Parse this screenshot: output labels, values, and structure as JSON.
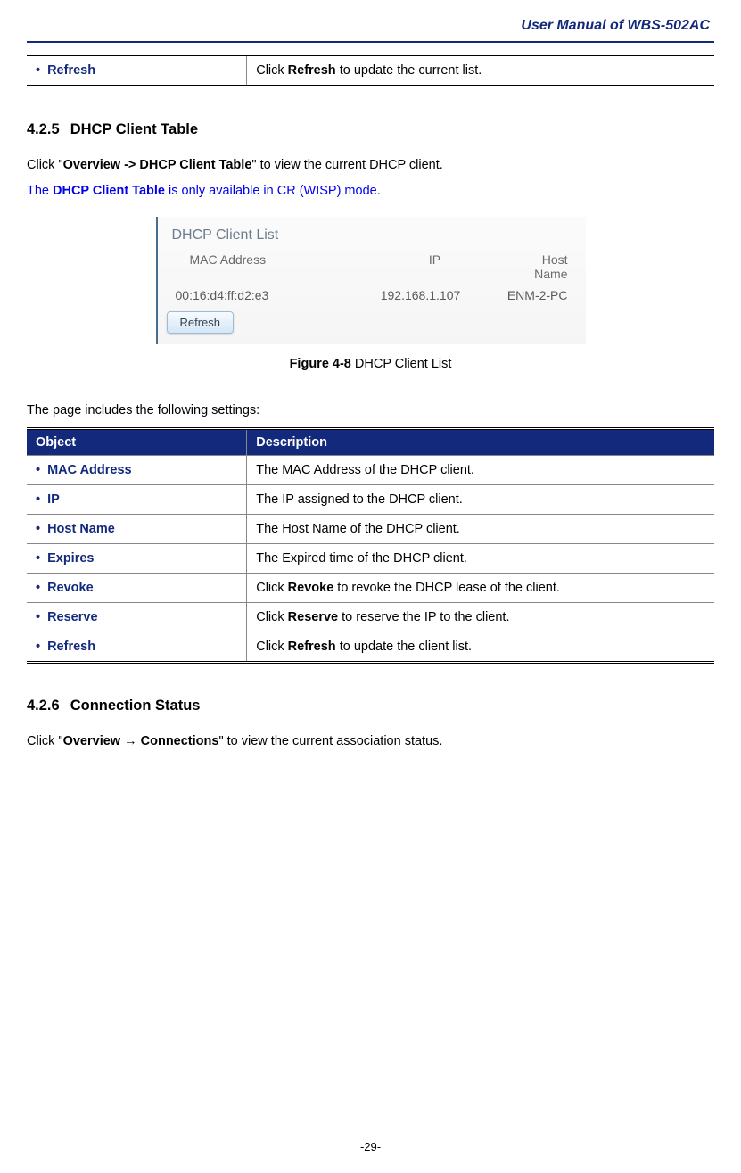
{
  "header": {
    "title": "User Manual of WBS-502AC"
  },
  "top_table": {
    "row": {
      "object": "Refresh",
      "description_pre": "Click ",
      "description_bold": "Refresh",
      "description_post": " to update the current list."
    }
  },
  "section_425": {
    "number": "4.2.5",
    "title": "DHCP Client Table",
    "p1_pre": "Click \"",
    "p1_bold": "Overview -> DHCP Client Table",
    "p1_post": "\" to view the current DHCP client.",
    "p2_pre": "The ",
    "p2_bold": "DHCP Client Table",
    "p2_post": " is only available in CR (WISP) mode.",
    "figure": {
      "panel_title": "DHCP Client List",
      "col_mac": "MAC Address",
      "col_ip": "IP",
      "col_host": "Host Name",
      "mac": "00:16:d4:ff:d2:e3",
      "ip": "192.168.1.107",
      "host": "ENM-2-PC",
      "refresh_btn": "Refresh",
      "caption_bold": "Figure 4-8",
      "caption_rest": " DHCP Client List"
    },
    "settings_intro": "The page includes the following settings:",
    "settings_header_object": "Object",
    "settings_header_desc": "Description",
    "rows": [
      {
        "object": "MAC Address",
        "pre": "The MAC Address of the DHCP client.",
        "bold": "",
        "post": ""
      },
      {
        "object": "IP",
        "pre": "The IP assigned to the DHCP client.",
        "bold": "",
        "post": ""
      },
      {
        "object": "Host Name",
        "pre": "The Host Name of the DHCP client.",
        "bold": "",
        "post": ""
      },
      {
        "object": "Expires",
        "pre": "The Expired time of the DHCP client.",
        "bold": "",
        "post": ""
      },
      {
        "object": "Revoke",
        "pre": "Click ",
        "bold": "Revoke",
        "post": " to revoke the DHCP lease of the client."
      },
      {
        "object": "Reserve",
        "pre": "Click ",
        "bold": "Reserve",
        "post": " to reserve the IP to the client."
      },
      {
        "object": "Refresh",
        "pre": "Click ",
        "bold": "Refresh",
        "post": " to update the client list."
      }
    ]
  },
  "section_426": {
    "number": "4.2.6",
    "title": "Connection Status",
    "p1_pre": "Click \"",
    "p1_bold": "Overview → Connections",
    "p1_post": "\" to view the current association status."
  },
  "page_number": "-29-"
}
